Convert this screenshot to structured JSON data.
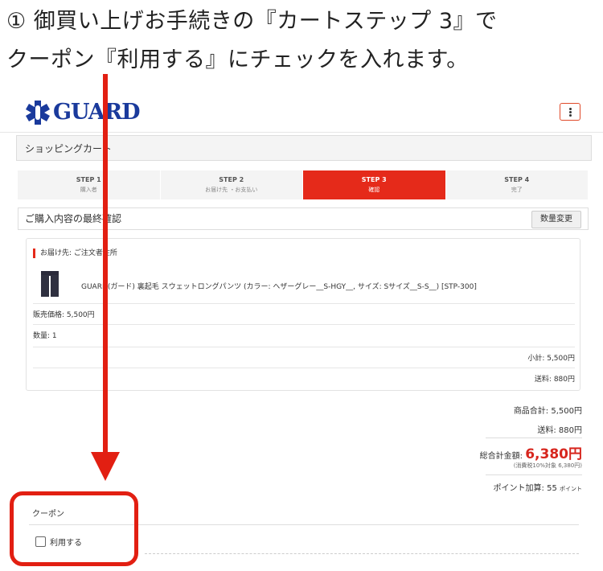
{
  "caption": {
    "line1": "① 御買い上げお手続きの『カートステップ 3』で",
    "line2": "クーポン『利用する』にチェックを入れます。"
  },
  "header": {
    "logo_text": "GUARD",
    "menu_icon": "more-vertical-icon"
  },
  "cart_title": "ショッピングカート",
  "steps": [
    {
      "title": "STEP 1",
      "desc": "購入者"
    },
    {
      "title": "STEP 2",
      "desc": "お届け先 ・お支払い"
    },
    {
      "title": "STEP 3",
      "desc": "確認"
    },
    {
      "title": "STEP 4",
      "desc": "完了"
    }
  ],
  "active_step": 3,
  "final_check": {
    "title": "ご購入内容の最終確認",
    "qty_button": "数量変更"
  },
  "order": {
    "ship_label": "お届け先: ご注文者住所",
    "product_name": "GUARD(ガード) 裏起毛 スウェットロングパンツ (カラー: ヘザーグレー__S-HGY__, サイズ: Sサイズ__S-S__) [STP-300]",
    "price_line": "販売価格: 5,500円",
    "qty_line": "数量: 1",
    "subtotal_line": "小計: 5,500円",
    "shipping_line": "送料: 880円"
  },
  "summary": {
    "goods_total": "商品合計: 5,500円",
    "shipping": "送料: 880円",
    "grand_label": "総合計金額:",
    "grand_value": "6,380円",
    "tax_note": "(消費税10%対象 6,380円)",
    "points_label": "ポイント加算: 55",
    "points_unit": "ポイント"
  },
  "coupon": {
    "title": "クーポン",
    "checkbox_label": "利用する"
  },
  "colors": {
    "accent": "#e52a1a",
    "logo": "#1a3a9c",
    "annotation": "#e21f12"
  }
}
